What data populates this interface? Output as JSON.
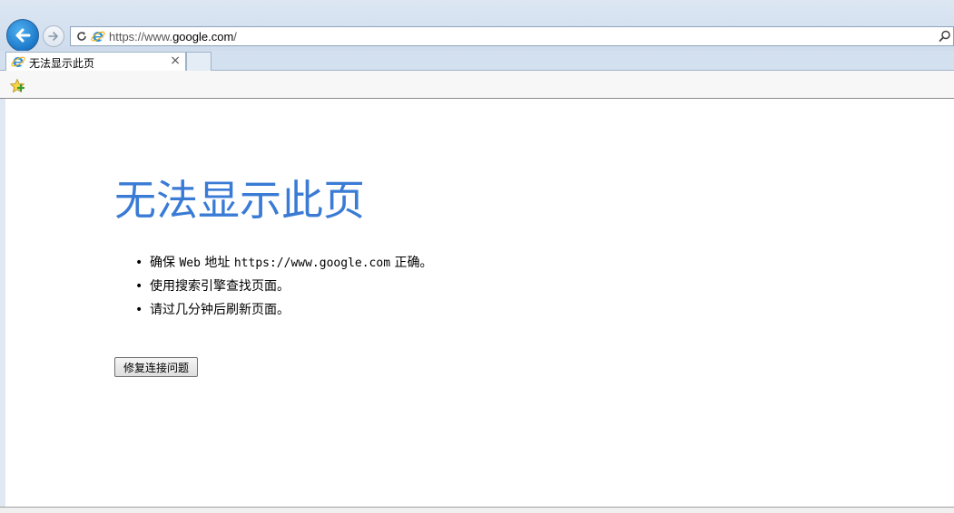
{
  "browser": {
    "address": {
      "scheme": "https://www.",
      "host": "google.com",
      "path": "/"
    },
    "tab": {
      "title": "无法显示此页",
      "close_glyph": "×"
    },
    "icons": {
      "back": "back-arrow-icon",
      "forward": "forward-arrow-icon",
      "refresh": "refresh-icon",
      "site": "ie-logo-icon",
      "search": "search-icon",
      "favorites": "favorites-star-icon"
    }
  },
  "page": {
    "title": "无法显示此页",
    "title_color": "#3a7bd5",
    "tips": [
      {
        "bullet": "•",
        "pre": "确保 ",
        "mono1": "Web",
        "mid": " 地址 ",
        "mono2": "https://www.google.com",
        "post": " 正确。"
      },
      {
        "bullet": "•",
        "text": "使用搜索引擎查找页面。"
      },
      {
        "bullet": "•",
        "text": "请过几分钟后刷新页面。"
      }
    ],
    "fix_button_label": "修复连接问题"
  }
}
